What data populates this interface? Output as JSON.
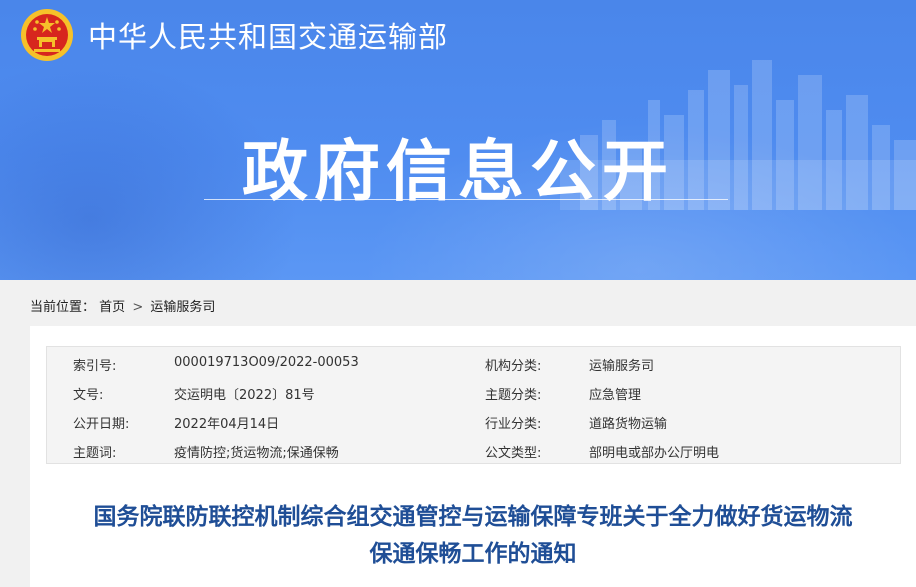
{
  "header": {
    "ministry_name": "中华人民共和国交通运输部",
    "headline": "政府信息公开"
  },
  "breadcrumb": {
    "prefix": "当前位置：",
    "items": [
      "首页",
      "运输服务司"
    ],
    "separator": ">"
  },
  "meta": {
    "rows": [
      {
        "label1": "索引号:",
        "value1": "000019713O09/2022-00053",
        "label2": "机构分类:",
        "value2": "运输服务司"
      },
      {
        "label1": "文号:",
        "value1": "交运明电〔2022〕81号",
        "label2": "主题分类:",
        "value2": "应急管理"
      },
      {
        "label1": "公开日期:",
        "value1": "2022年04月14日",
        "label2": "行业分类:",
        "value2": "道路货物运输"
      },
      {
        "label1": "主题词:",
        "value1": "疫情防控;货运物流;保通保畅",
        "label2": "公文类型:",
        "value2": "部明电或部办公厅明电"
      }
    ]
  },
  "document": {
    "title_line1": "国务院联防联控机制综合组交通管控与运输保障专班关于全力做好货运物流",
    "title_line2": "保通保畅工作的通知"
  },
  "colors": {
    "banner": "#4f8cf0",
    "title": "#1f4e96",
    "emblem_red": "#d7261e",
    "emblem_gold": "#f6c12a"
  }
}
